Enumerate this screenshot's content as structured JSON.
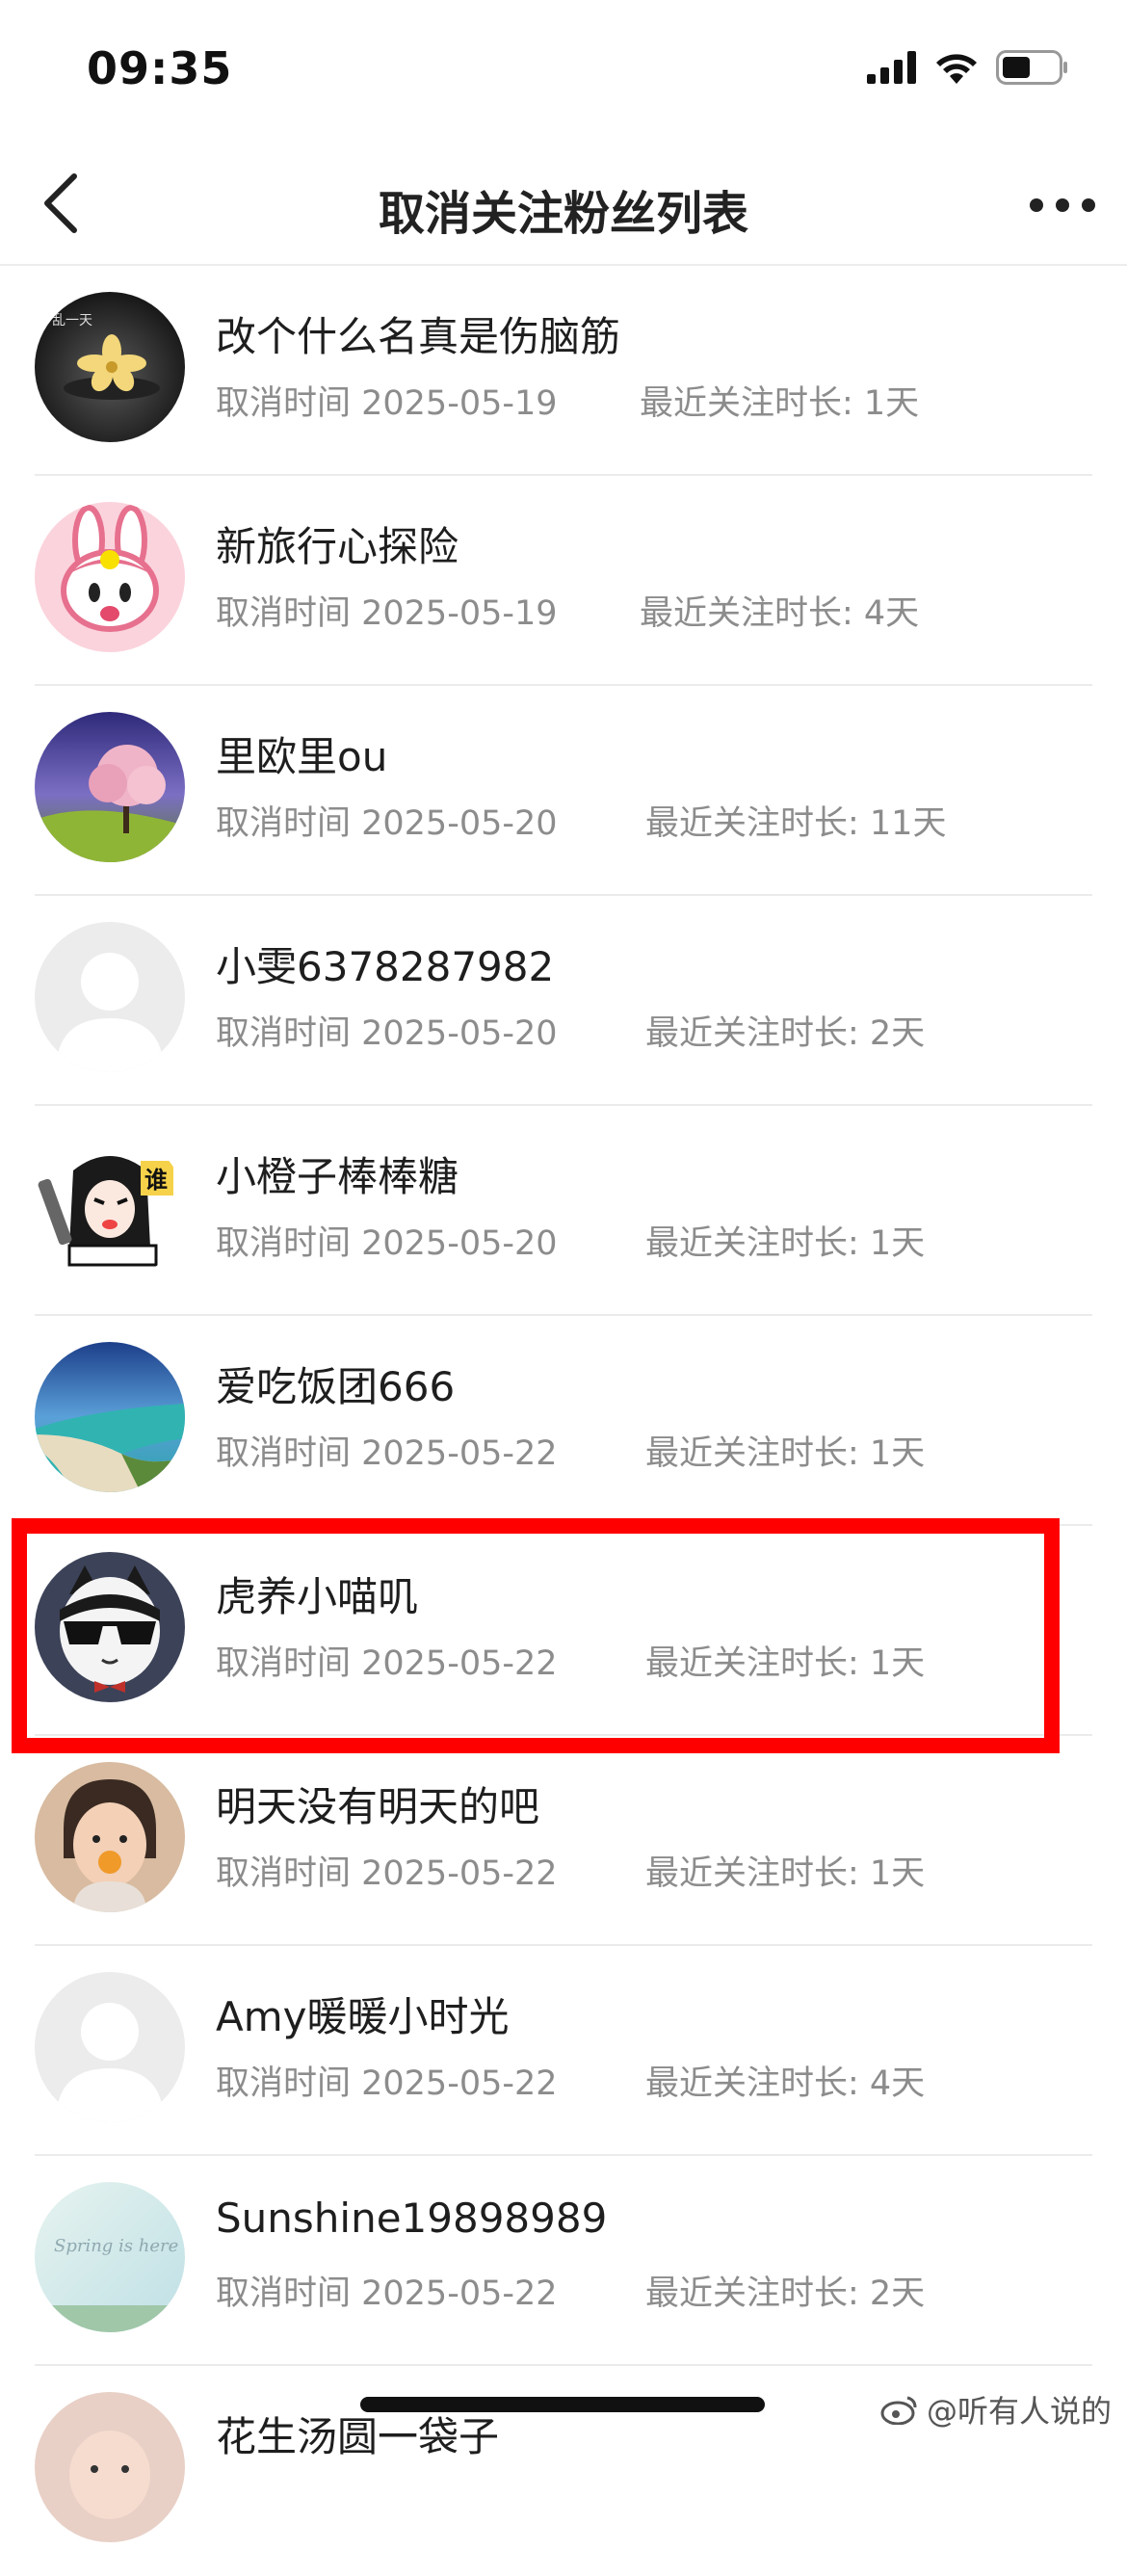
{
  "status_bar": {
    "time": "09:35",
    "icons": [
      "cellular-signal-icon",
      "wifi-icon",
      "battery-icon"
    ]
  },
  "nav": {
    "title": "取消关注粉丝列表",
    "back_icon": "chevron-left-icon",
    "more_icon": "more-dots-icon"
  },
  "items": [
    {
      "name": "改个什么名真是伤脑筋",
      "unfollow_time": "取消时间 2025-05-19",
      "duration": "最近关注时长: 1天",
      "avatar": "flower-photo"
    },
    {
      "name": "新旅行心探险",
      "unfollow_time": "取消时间 2025-05-19",
      "duration": "最近关注时长: 4天",
      "avatar": "pink-bunny"
    },
    {
      "name": "里欧里ou",
      "unfollow_time": "取消时间 2025-05-20",
      "duration": "最近关注时长: 11天",
      "avatar": "blossom-tree"
    },
    {
      "name": "小雯6378287982",
      "unfollow_time": "取消时间 2025-05-20",
      "duration": "最近关注时长: 2天",
      "avatar": "default-silhouette"
    },
    {
      "name": "小橙子棒棒糖",
      "unfollow_time": "取消时间 2025-05-20",
      "duration": "最近关注时长: 1天",
      "avatar": "comic-drawing"
    },
    {
      "name": "爱吃饭团666",
      "unfollow_time": "取消时间 2025-05-22",
      "duration": "最近关注时长: 1天",
      "avatar": "beach-photo"
    },
    {
      "name": "虎养小喵叽",
      "unfollow_time": "取消时间 2025-05-22",
      "duration": "最近关注时长: 1天",
      "avatar": "cat-sunglasses",
      "highlighted": true
    },
    {
      "name": "明天没有明天的吧",
      "unfollow_time": "取消时间 2025-05-22",
      "duration": "最近关注时长: 1天",
      "avatar": "child-photo"
    },
    {
      "name": "Amy暖暖小时光",
      "unfollow_time": "取消时间 2025-05-22",
      "duration": "最近关注时长: 4天",
      "avatar": "default-silhouette"
    },
    {
      "name": "Sunshine19898989",
      "unfollow_time": "取消时间 2025-05-22",
      "duration": "最近关注时长: 2天",
      "avatar": "spring-text-photo",
      "avatar_text": "Spring is here"
    },
    {
      "name": "花生汤圆一袋子",
      "unfollow_time": "",
      "duration": "",
      "avatar": "baby-photo"
    }
  ],
  "watermark": "@听有人说的",
  "colors": {
    "highlight": "#ff0000",
    "secondary_text": "#8c8c8c",
    "divider": "#ebebeb"
  }
}
